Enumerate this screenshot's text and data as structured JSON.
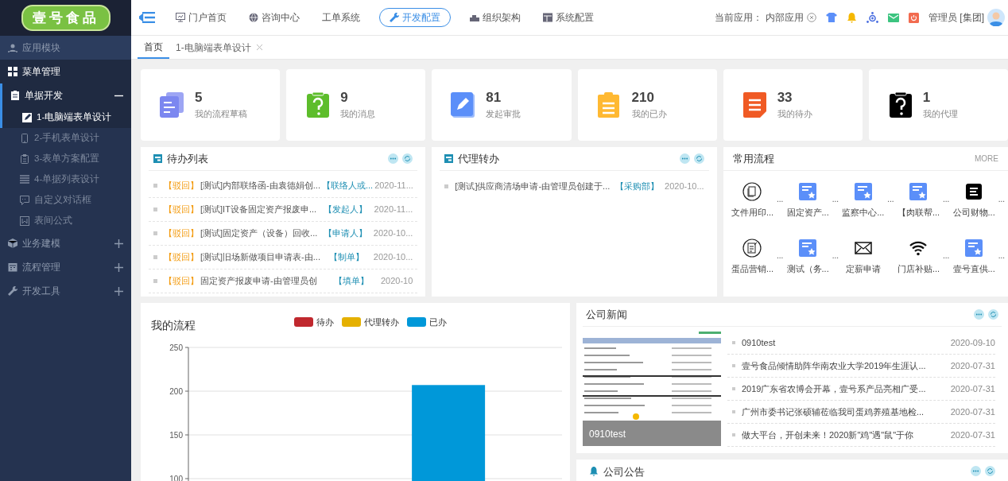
{
  "logo": {
    "text": "壹号食品"
  },
  "sidebar": {
    "items": [
      {
        "label": "应用模块",
        "kind": "header",
        "active": false
      },
      {
        "label": "菜单管理",
        "kind": "menu",
        "active": true
      },
      {
        "label": "单据开发",
        "kind": "menu",
        "active": true,
        "expanded": true,
        "children": [
          {
            "label": "1-电脑端表单设计",
            "selected": true
          },
          {
            "label": "2-手机表单设计",
            "selected": false
          },
          {
            "label": "3-表单方案配置",
            "selected": false
          },
          {
            "label": "4-单据列表设计",
            "selected": false
          },
          {
            "label": "自定义对话框",
            "selected": false
          },
          {
            "label": "表间公式",
            "selected": false
          }
        ]
      },
      {
        "label": "业务建模",
        "kind": "menu",
        "active": false,
        "expanded": false
      },
      {
        "label": "流程管理",
        "kind": "menu",
        "active": false,
        "expanded": false
      },
      {
        "label": "开发工具",
        "kind": "menu",
        "active": false,
        "expanded": false
      }
    ]
  },
  "top_nav": [
    {
      "label": "门户首页",
      "selected": false
    },
    {
      "label": "咨询中心",
      "selected": false
    },
    {
      "label": "工单系统",
      "selected": false
    },
    {
      "label": "开发配置",
      "selected": true
    },
    {
      "label": "组织架构",
      "selected": false
    },
    {
      "label": "系统配置",
      "selected": false
    }
  ],
  "header_right": {
    "app_label": "当前应用：",
    "app_value": "内部应用",
    "user": "管理员 [集团]"
  },
  "tabs": [
    {
      "label": "首页",
      "selected": true
    },
    {
      "label": "1-电脑端表单设计",
      "selected": false,
      "closable": true
    }
  ],
  "stats": [
    {
      "value": "5",
      "label": "我的流程草稿",
      "kind": "files",
      "color": "#7c87f0"
    },
    {
      "value": "9",
      "label": "我的消息",
      "kind": "question",
      "color": "#5dbd2b"
    },
    {
      "value": "81",
      "label": "发起审批",
      "kind": "edit",
      "color": "#5b8ff9"
    },
    {
      "value": "210",
      "label": "我的已办",
      "kind": "clipboard",
      "color": "#ffb932"
    },
    {
      "value": "33",
      "label": "我的待办",
      "kind": "doc",
      "color": "#f05a24"
    },
    {
      "value": "1",
      "label": "我的代理",
      "kind": "question",
      "color": "#000000"
    }
  ],
  "todo_list": {
    "title": "待办列表",
    "rows": [
      {
        "tag": "【驳回】",
        "title": "[测试]内部联络函-由袁德娟创...",
        "role": "【联络人或...",
        "date": "2020-11..."
      },
      {
        "tag": "【驳回】",
        "title": "[测试]IT设备固定资产报废申...",
        "role": "【发起人】",
        "date": "2020-11..."
      },
      {
        "tag": "【驳回】",
        "title": "[测试]固定资产（设备）回收...",
        "role": "【申请人】",
        "date": "2020-10..."
      },
      {
        "tag": "【驳回】",
        "title": "[测试]旧场新做项目申请表-由...",
        "role": "【制单】",
        "date": "2020-10..."
      },
      {
        "tag": "【驳回】",
        "title": "固定资产报废申请-由管理员创",
        "role": "【填单】",
        "date": "2020-10"
      }
    ]
  },
  "proxy_list": {
    "title": "代理转办",
    "rows": [
      {
        "title": "[测试]供应商清场申请-由管理员创建于...",
        "role": "【采购部】",
        "date": "2020-10..."
      }
    ]
  },
  "common_flows": {
    "title": "常用流程",
    "more": "MORE",
    "items": [
      {
        "label": "文件用印...",
        "kind": "circle-doc",
        "suffix": "..."
      },
      {
        "label": "固定资产...",
        "kind": "star-doc",
        "suffix": "..."
      },
      {
        "label": "监察中心...",
        "kind": "star-doc",
        "suffix": "..."
      },
      {
        "label": "【肉联帮...",
        "kind": "star-doc",
        "suffix": "..."
      },
      {
        "label": "公司财物...",
        "kind": "black-doc",
        "suffix": "..."
      },
      {
        "label": "蛋品营销...",
        "kind": "circle-edit",
        "suffix": "..."
      },
      {
        "label": "测试（务...",
        "kind": "star-doc",
        "suffix": "..."
      },
      {
        "label": "定薪申请",
        "kind": "mail"
      },
      {
        "label": "门店补贴...",
        "kind": "wifi",
        "suffix": "..."
      },
      {
        "label": "壹号直供...",
        "kind": "star-doc",
        "suffix": "..."
      }
    ]
  },
  "my_flows": {
    "title": "我的流程",
    "chart_data": {
      "type": "bar",
      "series": [
        {
          "name": "待办",
          "color": "#c0282e",
          "values": [
            null
          ]
        },
        {
          "name": "代理转办",
          "color": "#e5b000",
          "values": [
            null
          ]
        },
        {
          "name": "已办",
          "color": "#0098d9",
          "values": [
            207
          ]
        }
      ],
      "ylim": [
        100,
        250
      ],
      "yticks": [
        100,
        150,
        200,
        250
      ]
    }
  },
  "news": {
    "title": "公司新闻",
    "image_caption": "0910test",
    "items": [
      {
        "title": "0910test",
        "date": "2020-09-10"
      },
      {
        "title": "壹号食品倾情助阵华南农业大学2019年生涯认...",
        "date": "2020-07-31"
      },
      {
        "title": "2019广东省农博会开幕，壹号系产品亮相广受...",
        "date": "2020-07-31"
      },
      {
        "title": "广州市委书记张硕辅莅临我司蛋鸡养殖基地检...",
        "date": "2020-07-31"
      },
      {
        "title": "做大平台，开创未来！2020新\"鸡\"遇\"鼠\"于你",
        "date": "2020-07-31"
      }
    ]
  },
  "notices": {
    "title": "公司公告"
  }
}
